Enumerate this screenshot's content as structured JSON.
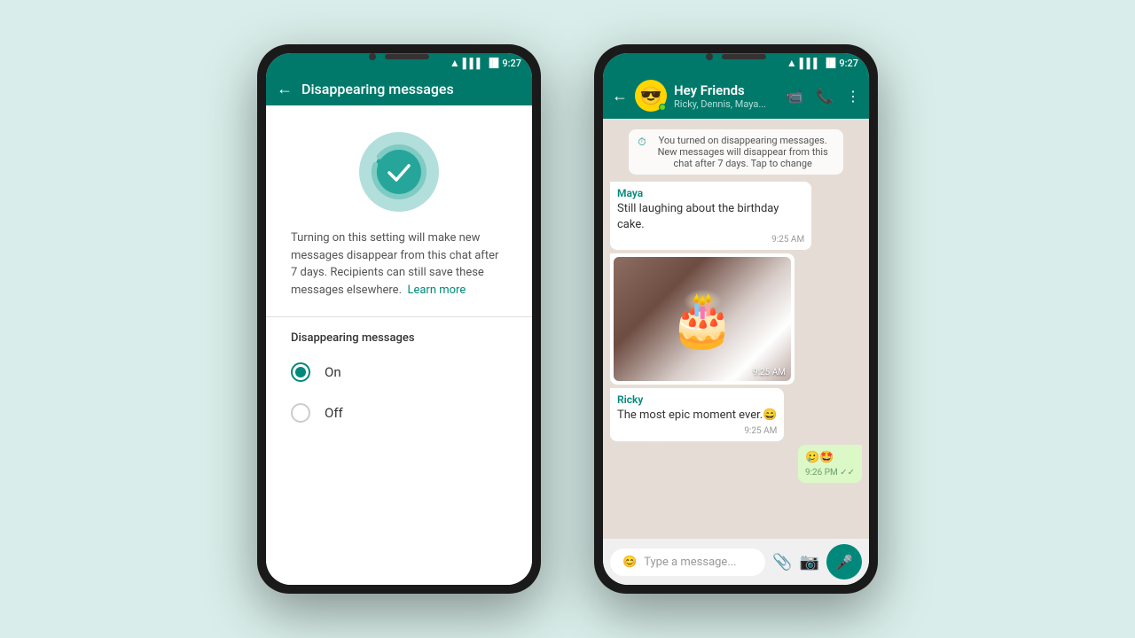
{
  "background_color": "#d9eeea",
  "phone1": {
    "status_bar": {
      "time": "9:27"
    },
    "header": {
      "title": "Disappearing messages",
      "back_label": "←"
    },
    "description": "Turning on this setting will make new messages disappear from this chat after 7 days. Recipients can still save these messages elsewhere.",
    "learn_more": "Learn more",
    "section_title": "Disappearing messages",
    "options": [
      {
        "label": "On",
        "selected": true
      },
      {
        "label": "Off",
        "selected": false
      }
    ]
  },
  "phone2": {
    "status_bar": {
      "time": "9:27"
    },
    "header": {
      "name": "Hey Friends",
      "subtitle": "Ricky, Dennis, Maya...",
      "back_label": "←"
    },
    "system_message": "You turned on disappearing messages. New messages will disappear from this chat after 7 days. Tap to change",
    "messages": [
      {
        "type": "received",
        "sender": "Maya",
        "text": "Still laughing about the birthday cake.",
        "time": "9:25 AM",
        "has_image": false
      },
      {
        "type": "received",
        "sender": null,
        "text": null,
        "time": "9:25 AM",
        "has_image": true
      },
      {
        "type": "received",
        "sender": "Ricky",
        "text": "The most epic moment ever.😄",
        "time": "9:25 AM",
        "has_image": false
      },
      {
        "type": "sent",
        "sender": null,
        "text": "🥲🤩",
        "time": "9:26 PM ✓✓",
        "has_image": false
      }
    ],
    "input_placeholder": "Type a message...",
    "icons": {
      "video": "📹",
      "call": "📞",
      "more": "⋮",
      "emoji": "😊",
      "attach": "📎",
      "camera": "📷",
      "mic": "🎤"
    }
  }
}
